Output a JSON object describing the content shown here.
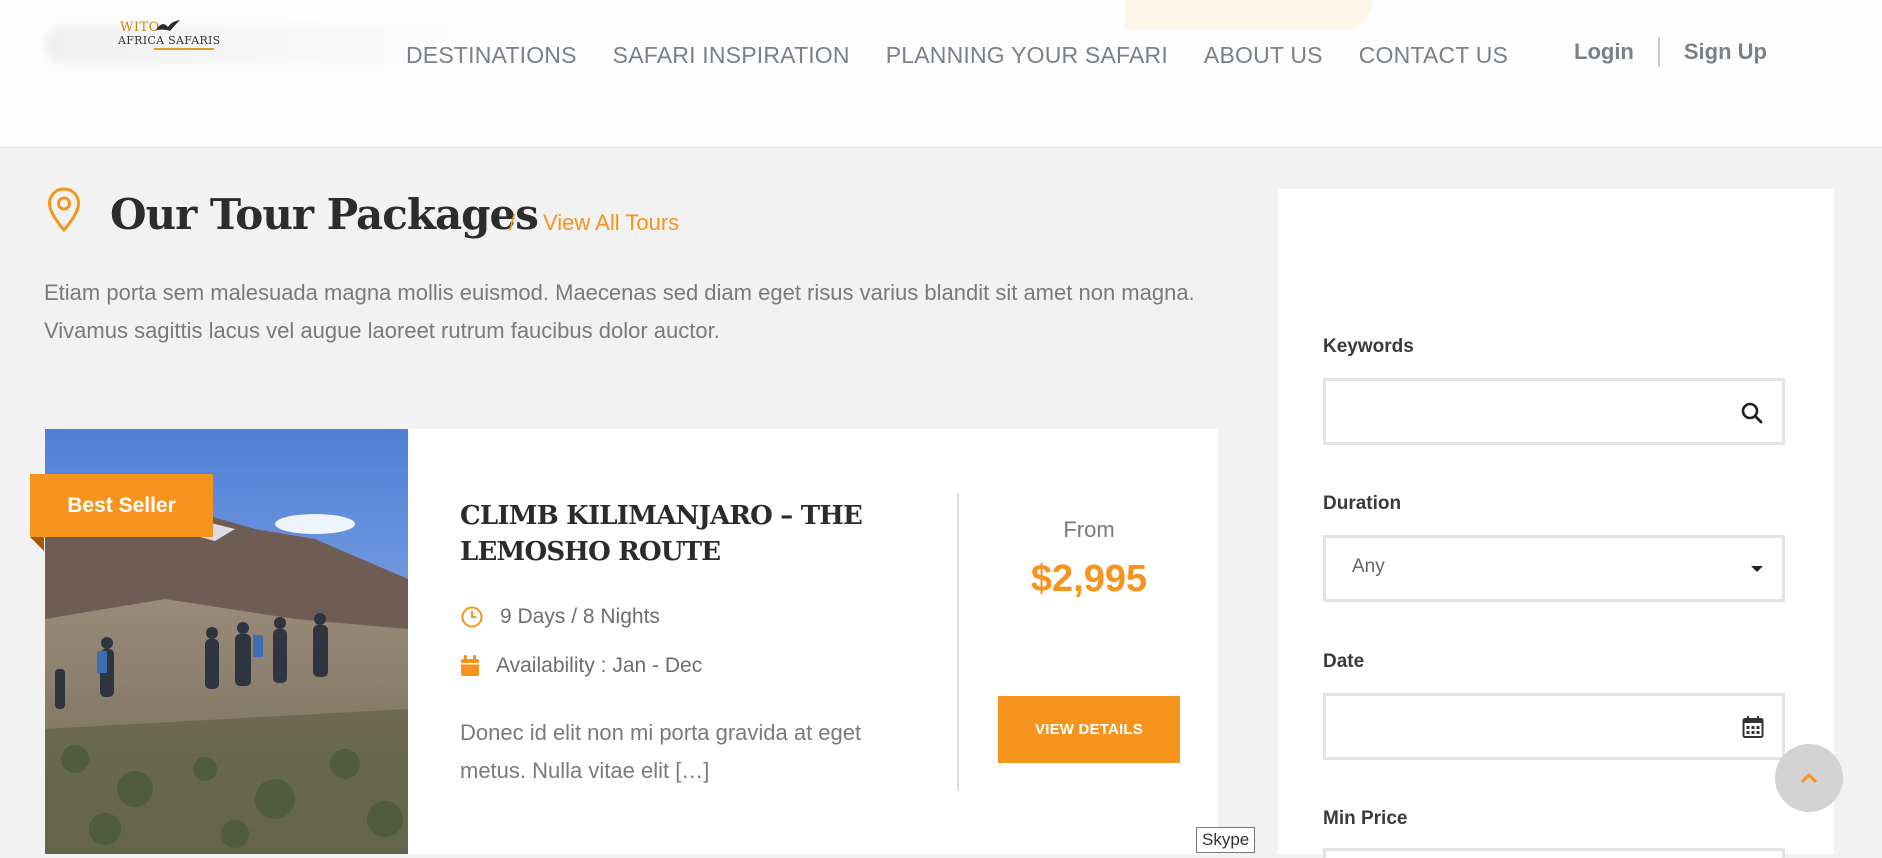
{
  "brand": {
    "logo_line1": "WITO",
    "logo_line2": "AFRICA SAFARIS"
  },
  "nav": {
    "items": [
      {
        "label": "DESTINATIONS"
      },
      {
        "label": "SAFARI INSPIRATION"
      },
      {
        "label": "PLANNING YOUR SAFARI"
      },
      {
        "label": "ABOUT US"
      },
      {
        "label": "CONTACT US"
      }
    ],
    "login_label": "Login",
    "signup_label": "Sign Up"
  },
  "section": {
    "title": "Our Tour Packages",
    "separator": "/",
    "view_all_label": "View All Tours",
    "intro": "Etiam porta sem malesuada magna mollis euismod. Maecenas sed diam eget risus varius blandit sit amet non magna. Vivamus sagittis lacus vel augue laoreet rutrum faucibus dolor auctor."
  },
  "tour": {
    "badge": "Best Seller",
    "title": "CLIMB KILIMANJARO – THE LEMOSHO ROUTE",
    "duration": "9 Days / 8 Nights",
    "availability": "Availability : Jan - Dec",
    "description": "Donec id elit non mi porta gravida at eget metus. Nulla vitae elit […]",
    "from_label": "From",
    "price": "$2,995",
    "button_label": "VIEW DETAILS"
  },
  "filters": {
    "keywords_label": "Keywords",
    "keywords_value": "",
    "duration_label": "Duration",
    "duration_value": "Any",
    "date_label": "Date",
    "date_value": "",
    "min_price_label": "Min Price"
  },
  "tooltip": {
    "text": "Skype"
  },
  "colors": {
    "accent": "#f7941d",
    "background": "#f2f2f2",
    "nav_text": "#7b7f8a"
  },
  "icons": {
    "location": "map-pin-icon",
    "clock": "clock-icon",
    "calendar": "calendar-icon",
    "search": "search-icon",
    "dropdown": "caret-down-icon",
    "date": "calendar-grid-icon",
    "scroll_top": "chevron-up-icon"
  }
}
